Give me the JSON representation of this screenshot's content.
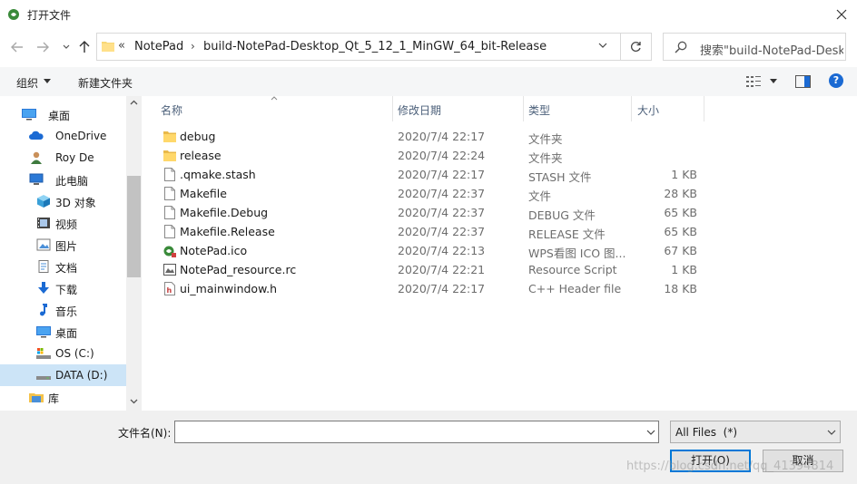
{
  "window": {
    "title": "打开文件",
    "close_symbol": "✕"
  },
  "address": {
    "overflow": "«",
    "segments": [
      "NotePad",
      "build-NotePad-Desktop_Qt_5_12_1_MinGW_64_bit-Release"
    ],
    "separator": "›"
  },
  "search": {
    "placeholder": "搜索\"build-NotePad-Desk..."
  },
  "toolbar": {
    "organize": "组织",
    "new_folder": "新建文件夹",
    "help": "?"
  },
  "nav": [
    {
      "label": "桌面",
      "icon": "desktop-icon"
    },
    {
      "label": "OneDrive",
      "icon": "cloud-icon"
    },
    {
      "label": "Roy De",
      "icon": "user-icon"
    },
    {
      "label": "此电脑",
      "icon": "computer-icon"
    },
    {
      "label": "3D 对象",
      "icon": "cube-icon"
    },
    {
      "label": "视频",
      "icon": "video-icon"
    },
    {
      "label": "图片",
      "icon": "picture-icon"
    },
    {
      "label": "文档",
      "icon": "document-icon"
    },
    {
      "label": "下载",
      "icon": "download-icon"
    },
    {
      "label": "音乐",
      "icon": "music-icon"
    },
    {
      "label": "桌面",
      "icon": "desktop-icon"
    },
    {
      "label": "OS (C:)",
      "icon": "drive-os-icon"
    },
    {
      "label": "DATA (D:)",
      "icon": "drive-icon"
    },
    {
      "label": "库",
      "icon": "library-icon"
    }
  ],
  "columns": {
    "name": "名称",
    "date": "修改日期",
    "type": "类型",
    "size": "大小"
  },
  "files": [
    {
      "name": "debug",
      "date": "2020/7/4 22:17",
      "type": "文件夹",
      "size": "",
      "icon": "folder-icon"
    },
    {
      "name": "release",
      "date": "2020/7/4 22:24",
      "type": "文件夹",
      "size": "",
      "icon": "folder-icon"
    },
    {
      "name": ".qmake.stash",
      "date": "2020/7/4 22:17",
      "type": "STASH 文件",
      "size": "1 KB",
      "icon": "file-icon"
    },
    {
      "name": "Makefile",
      "date": "2020/7/4 22:37",
      "type": "文件",
      "size": "28 KB",
      "icon": "file-icon"
    },
    {
      "name": "Makefile.Debug",
      "date": "2020/7/4 22:37",
      "type": "DEBUG 文件",
      "size": "65 KB",
      "icon": "file-icon"
    },
    {
      "name": "Makefile.Release",
      "date": "2020/7/4 22:37",
      "type": "RELEASE 文件",
      "size": "65 KB",
      "icon": "file-icon"
    },
    {
      "name": "NotePad.ico",
      "date": "2020/7/4 22:13",
      "type": "WPS看图 ICO 图...",
      "size": "67 KB",
      "icon": "ico-file-icon"
    },
    {
      "name": "NotePad_resource.rc",
      "date": "2020/7/4 22:21",
      "type": "Resource Script",
      "size": "1 KB",
      "icon": "rc-file-icon"
    },
    {
      "name": "ui_mainwindow.h",
      "date": "2020/7/4 22:17",
      "type": "C++ Header file",
      "size": "18 KB",
      "icon": "header-file-icon"
    }
  ],
  "bottom": {
    "filename_label": "文件名(N):",
    "filename_value": "",
    "filetype": "All Files  (*)",
    "open": "打开(O)",
    "cancel": "取消"
  },
  "watermark": "https://blog.csdn.net/qq_41394814"
}
